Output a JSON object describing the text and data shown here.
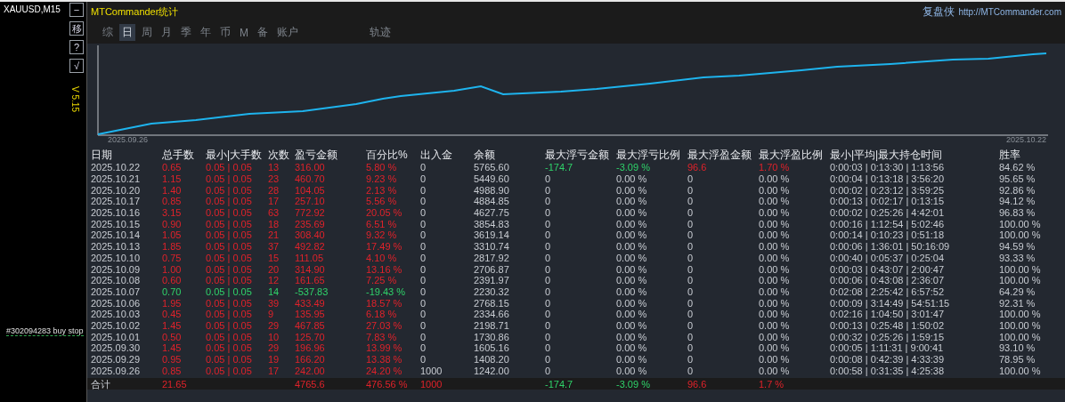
{
  "chart_window": {
    "symbol": "XAUUSD,M15",
    "side_buttons": [
      "−",
      "移",
      "?",
      "√"
    ],
    "version": "V 5.15",
    "order_label": "#302094283 buy stop"
  },
  "panel": {
    "title": "MTCommander统计",
    "brand": "复盘侠",
    "link": "http://MTCommander.com",
    "tabs": [
      {
        "label": "综",
        "selected": false
      },
      {
        "label": "日",
        "selected": true
      },
      {
        "label": "周",
        "selected": false
      },
      {
        "label": "月",
        "selected": false
      },
      {
        "label": "季",
        "selected": false
      },
      {
        "label": "年",
        "selected": false
      },
      {
        "label": "币",
        "selected": false
      },
      {
        "label": "M",
        "selected": false
      },
      {
        "label": "备",
        "selected": false
      },
      {
        "label": "账户",
        "selected": false
      },
      {
        "label": "轨迹",
        "selected": false
      }
    ],
    "chart": {
      "start_label": "2025.09.26",
      "end_label": "2025.10.22"
    },
    "table": {
      "columns": [
        "日期",
        "总手数",
        "最小|大手数",
        "次数",
        "盈亏金额",
        "百分比%",
        "出入金",
        "余额",
        "最大浮亏金额",
        "最大浮亏比例",
        "最大浮盈金额",
        "最大浮盈比例",
        "最小|平均|最大持仓时间",
        "胜率"
      ],
      "rows": [
        {
          "loss": false,
          "float_marked": true,
          "cells": [
            "2025.10.22",
            "0.65",
            "0.05 | 0.05",
            "13",
            "316.00",
            "5.80 %",
            "0",
            "5765.60",
            "-174.7",
            "-3.09 %",
            "96.6",
            "1.70 %",
            "0:00:03 | 0:13:30 | 1:13:56",
            "84.62 %"
          ]
        },
        {
          "loss": false,
          "float_marked": false,
          "cells": [
            "2025.10.21",
            "1.15",
            "0.05 | 0.05",
            "23",
            "460.70",
            "9.23 %",
            "0",
            "5449.60",
            "0",
            "0.00 %",
            "0",
            "0.00 %",
            "0:00:04 | 0:13:18 | 3:56:20",
            "95.65 %"
          ]
        },
        {
          "loss": false,
          "float_marked": false,
          "cells": [
            "2025.10.20",
            "1.40",
            "0.05 | 0.05",
            "28",
            "104.05",
            "2.13 %",
            "0",
            "4988.90",
            "0",
            "0.00 %",
            "0",
            "0.00 %",
            "0:00:02 | 0:23:12 | 3:59:25",
            "92.86 %"
          ]
        },
        {
          "loss": false,
          "float_marked": false,
          "cells": [
            "2025.10.17",
            "0.85",
            "0.05 | 0.05",
            "17",
            "257.10",
            "5.56 %",
            "0",
            "4884.85",
            "0",
            "0.00 %",
            "0",
            "0.00 %",
            "0:00:13 | 0:02:17 | 0:13:15",
            "94.12 %"
          ]
        },
        {
          "loss": false,
          "float_marked": false,
          "cells": [
            "2025.10.16",
            "3.15",
            "0.05 | 0.05",
            "63",
            "772.92",
            "20.05 %",
            "0",
            "4627.75",
            "0",
            "0.00 %",
            "0",
            "0.00 %",
            "0:00:02 | 0:25:26 | 4:42:01",
            "96.83 %"
          ]
        },
        {
          "loss": false,
          "float_marked": false,
          "cells": [
            "2025.10.15",
            "0.90",
            "0.05 | 0.05",
            "18",
            "235.69",
            "6.51 %",
            "0",
            "3854.83",
            "0",
            "0.00 %",
            "0",
            "0.00 %",
            "0:00:16 | 1:12:54 | 5:02:46",
            "100.00 %"
          ]
        },
        {
          "loss": false,
          "float_marked": false,
          "cells": [
            "2025.10.14",
            "1.05",
            "0.05 | 0.05",
            "21",
            "308.40",
            "9.32 %",
            "0",
            "3619.14",
            "0",
            "0.00 %",
            "0",
            "0.00 %",
            "0:00:14 | 0:10:23 | 0:51:18",
            "100.00 %"
          ]
        },
        {
          "loss": false,
          "float_marked": false,
          "cells": [
            "2025.10.13",
            "1.85",
            "0.05 | 0.05",
            "37",
            "492.82",
            "17.49 %",
            "0",
            "3310.74",
            "0",
            "0.00 %",
            "0",
            "0.00 %",
            "0:00:06 | 1:36:01 | 50:16:09",
            "94.59 %"
          ]
        },
        {
          "loss": false,
          "float_marked": false,
          "cells": [
            "2025.10.10",
            "0.75",
            "0.05 | 0.05",
            "15",
            "111.05",
            "4.10 %",
            "0",
            "2817.92",
            "0",
            "0.00 %",
            "0",
            "0.00 %",
            "0:00:40 | 0:05:37 | 0:25:04",
            "93.33 %"
          ]
        },
        {
          "loss": false,
          "float_marked": false,
          "cells": [
            "2025.10.09",
            "1.00",
            "0.05 | 0.05",
            "20",
            "314.90",
            "13.16 %",
            "0",
            "2706.87",
            "0",
            "0.00 %",
            "0",
            "0.00 %",
            "0:00:03 | 0:43:07 | 2:00:47",
            "100.00 %"
          ]
        },
        {
          "loss": false,
          "float_marked": false,
          "cells": [
            "2025.10.08",
            "0.60",
            "0.05 | 0.05",
            "12",
            "161.65",
            "7.25 %",
            "0",
            "2391.97",
            "0",
            "0.00 %",
            "0",
            "0.00 %",
            "0:00:06 | 0:43:08 | 2:36:07",
            "100.00 %"
          ]
        },
        {
          "loss": true,
          "float_marked": false,
          "cells": [
            "2025.10.07",
            "0.70",
            "0.05 | 0.05",
            "14",
            "-537.83",
            "-19.43 %",
            "0",
            "2230.32",
            "0",
            "0.00 %",
            "0",
            "0.00 %",
            "0:02:08 | 2:25:42 | 6:57:52",
            "64.29 %"
          ]
        },
        {
          "loss": false,
          "float_marked": false,
          "cells": [
            "2025.10.06",
            "1.95",
            "0.05 | 0.05",
            "39",
            "433.49",
            "18.57 %",
            "0",
            "2768.15",
            "0",
            "0.00 %",
            "0",
            "0.00 %",
            "0:00:09 | 3:14:49 | 54:51:15",
            "92.31 %"
          ]
        },
        {
          "loss": false,
          "float_marked": false,
          "cells": [
            "2025.10.03",
            "0.45",
            "0.05 | 0.05",
            "9",
            "135.95",
            "6.18 %",
            "0",
            "2334.66",
            "0",
            "0.00 %",
            "0",
            "0.00 %",
            "0:02:16 | 1:04:50 | 3:01:47",
            "100.00 %"
          ]
        },
        {
          "loss": false,
          "float_marked": false,
          "cells": [
            "2025.10.02",
            "1.45",
            "0.05 | 0.05",
            "29",
            "467.85",
            "27.03 %",
            "0",
            "2198.71",
            "0",
            "0.00 %",
            "0",
            "0.00 %",
            "0:00:13 | 0:25:48 | 1:50:02",
            "100.00 %"
          ]
        },
        {
          "loss": false,
          "float_marked": false,
          "cells": [
            "2025.10.01",
            "0.50",
            "0.05 | 0.05",
            "10",
            "125.70",
            "7.83 %",
            "0",
            "1730.86",
            "0",
            "0.00 %",
            "0",
            "0.00 %",
            "0:00:32 | 0:25:26 | 1:59:15",
            "100.00 %"
          ]
        },
        {
          "loss": false,
          "float_marked": false,
          "cells": [
            "2025.09.30",
            "1.45",
            "0.05 | 0.05",
            "29",
            "196.96",
            "13.99 %",
            "0",
            "1605.16",
            "0",
            "0.00 %",
            "0",
            "0.00 %",
            "0:00:05 | 1:11:31 | 9:00:41",
            "93.10 %"
          ]
        },
        {
          "loss": false,
          "float_marked": false,
          "cells": [
            "2025.09.29",
            "0.95",
            "0.05 | 0.05",
            "19",
            "166.20",
            "13.38 %",
            "0",
            "1408.20",
            "0",
            "0.00 %",
            "0",
            "0.00 %",
            "0:00:08 | 0:42:39 | 4:33:39",
            "78.95 %"
          ]
        },
        {
          "loss": false,
          "float_marked": false,
          "cells": [
            "2025.09.26",
            "0.85",
            "0.05 | 0.05",
            "17",
            "242.00",
            "24.20 %",
            "1000",
            "1242.00",
            "0",
            "0.00 %",
            "0",
            "0.00 %",
            "0:00:58 | 0:31:35 | 4:25:38",
            "100.00 %"
          ]
        }
      ],
      "total": {
        "label": "合计",
        "lots": "21.65",
        "profit": "4765.6",
        "percent": "476.56 %",
        "deposit": "1000",
        "max_float_loss": "-174.7",
        "max_float_loss_pct": "-3.09 %",
        "max_float_profit": "96.6",
        "max_float_profit_pct": "1.7 %"
      }
    }
  }
}
